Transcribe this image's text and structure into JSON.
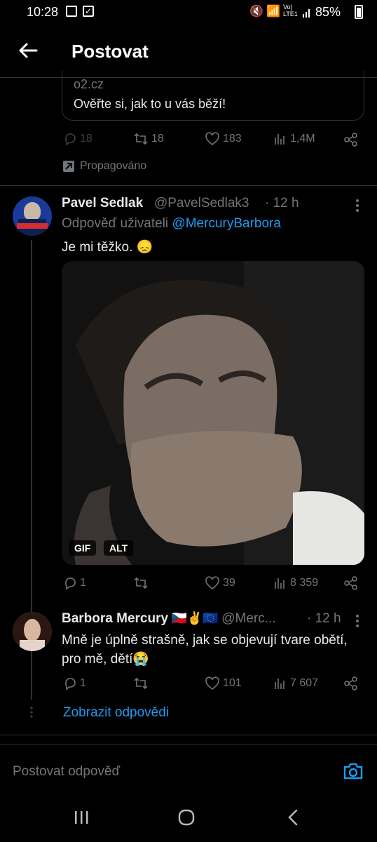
{
  "status": {
    "time": "10:28",
    "battery": "85%",
    "network": "Vo) LTE1"
  },
  "header": {
    "title": "Postovat"
  },
  "ad": {
    "domain": "o2.cz",
    "headline": "Ověřte si, jak to u vás běží!",
    "replies": "18",
    "retweets": "18",
    "likes": "183",
    "views": "1,4M",
    "promoted": "Propagováno"
  },
  "tweet1": {
    "name": "Pavel Sedlak",
    "handle": "@PavelSedlak3",
    "time": "· 12 h",
    "reply_prefix": "Odpověď uživateli",
    "reply_to": "@MercuryBarbora",
    "text": "Je mi těžko. 😞",
    "media_badges": [
      "GIF",
      "ALT"
    ],
    "replies": "1",
    "retweets": "",
    "likes": "39",
    "views": "8 359"
  },
  "tweet2": {
    "name": "Barbora Mercury",
    "flags": "🇨🇿✌🇪🇺",
    "handle": "@Merc...",
    "time": "· 12 h",
    "text": "Mně je úplně strašně, jak se objevují tvare obětí, pro mě, dětí😭",
    "replies": "1",
    "retweets": "",
    "likes": "101",
    "views": "7 607"
  },
  "show_replies": "Zobrazit odpovědi",
  "composer": {
    "placeholder": "Postovat odpověď"
  },
  "colors": {
    "accent": "#1d9bf0",
    "muted": "#71767b",
    "bg": "#000000",
    "text": "#e7e9ea"
  }
}
